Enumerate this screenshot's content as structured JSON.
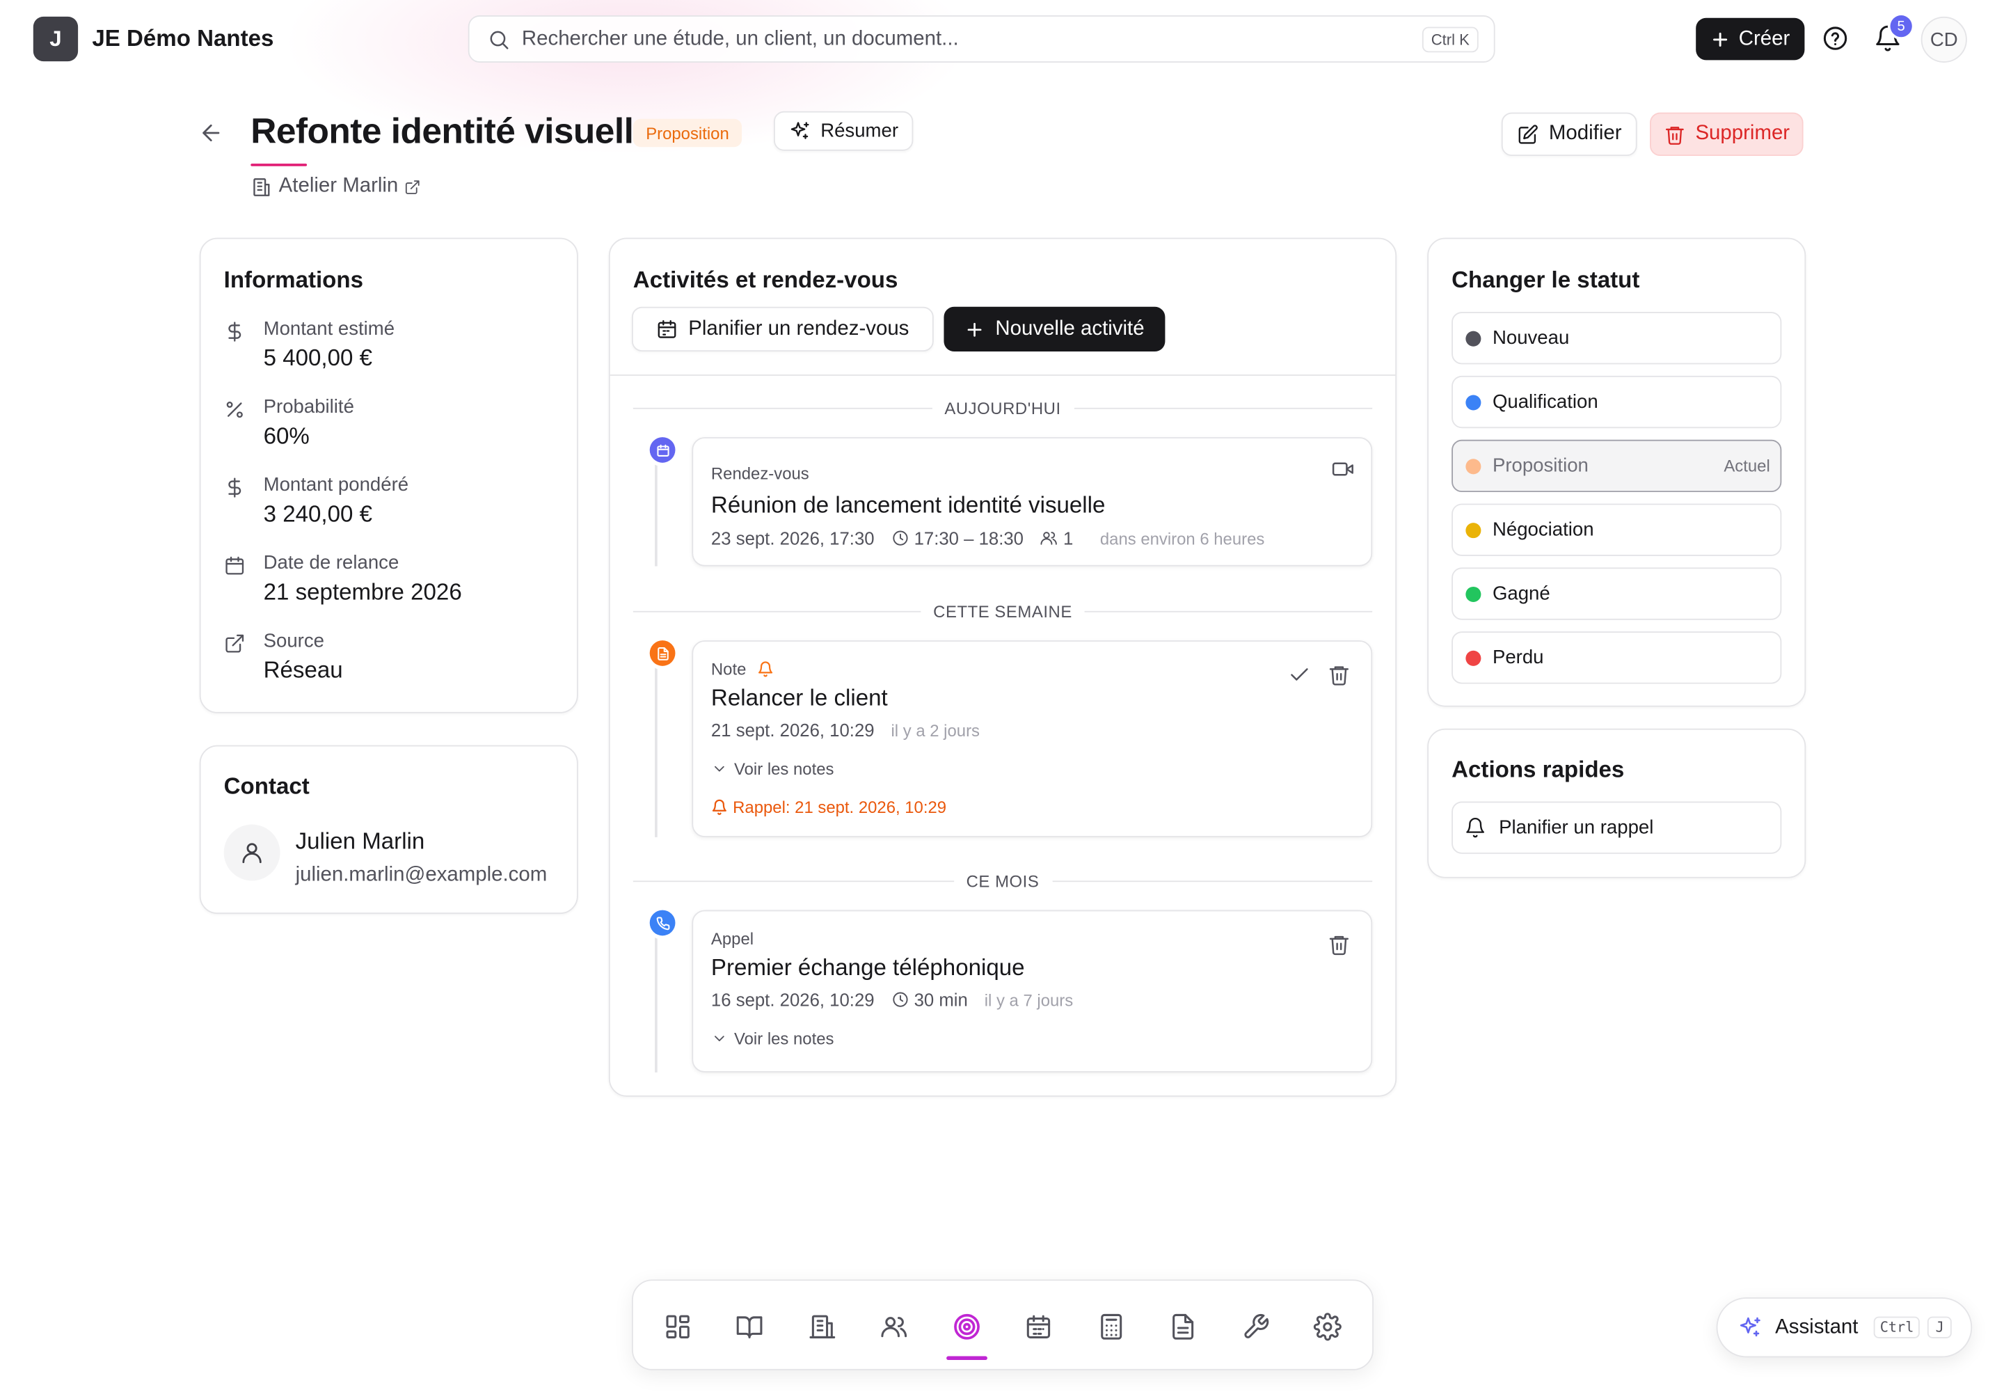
{
  "app": {
    "logo_letter": "J",
    "org_name": "JE Démo Nantes"
  },
  "search": {
    "placeholder": "Rechercher une étude, un client, un document...",
    "shortcut": "Ctrl K"
  },
  "topbar": {
    "create_label": "Créer",
    "notifications_count": "5",
    "avatar_initials": "CD"
  },
  "page": {
    "title": "Refonte identité visuelle",
    "status_badge": "Proposition",
    "summarize_label": "Résumer",
    "client_name": "Atelier Marlin",
    "edit_label": "Modifier",
    "delete_label": "Supprimer"
  },
  "info": {
    "title": "Informations",
    "rows": [
      {
        "label": "Montant estimé",
        "value": "5 400,00 €",
        "icon": "dollar-icon"
      },
      {
        "label": "Probabilité",
        "value": "60%",
        "icon": "percent-icon"
      },
      {
        "label": "Montant pondéré",
        "value": "3 240,00 €",
        "icon": "dollar-icon"
      },
      {
        "label": "Date de relance",
        "value": "21 septembre 2026",
        "icon": "calendar-icon"
      },
      {
        "label": "Source",
        "value": "Réseau",
        "icon": "external-link-icon"
      }
    ]
  },
  "contact": {
    "title": "Contact",
    "name": "Julien Marlin",
    "email": "julien.marlin@example.com"
  },
  "activities": {
    "title": "Activités et rendez-vous",
    "schedule_label": "Planifier un rendez-vous",
    "new_label": "Nouvelle activité",
    "groups": [
      "AUJOURD'HUI",
      "CETTE SEMAINE",
      "CE MOIS"
    ],
    "items": [
      {
        "type": "Rendez-vous",
        "title": "Réunion de lancement identité visuelle",
        "date": "23 sept. 2026, 17:30",
        "time_range": "17:30 – 18:30",
        "participants": "1",
        "relative": "dans environ 6 heures",
        "color": "#6366f1"
      },
      {
        "type": "Note",
        "title": "Relancer le client",
        "date": "21 sept. 2026, 10:29",
        "relative": "il y a 2 jours",
        "notes_toggle": "Voir les notes",
        "reminder": "Rappel: 21 sept. 2026, 10:29",
        "color": "#f97316"
      },
      {
        "type": "Appel",
        "title": "Premier échange téléphonique",
        "date": "16 sept. 2026, 10:29",
        "duration": "30 min",
        "relative": "il y a 7 jours",
        "notes_toggle": "Voir les notes",
        "color": "#3b82f6"
      }
    ]
  },
  "status": {
    "title": "Changer le statut",
    "current_label": "Actuel",
    "options": [
      {
        "label": "Nouveau",
        "color": "#52525b"
      },
      {
        "label": "Qualification",
        "color": "#3b82f6"
      },
      {
        "label": "Proposition",
        "color": "#fdba8c"
      },
      {
        "label": "Négociation",
        "color": "#eab308"
      },
      {
        "label": "Gagné",
        "color": "#22c55e"
      },
      {
        "label": "Perdu",
        "color": "#ef4444"
      }
    ]
  },
  "quick": {
    "title": "Actions rapides",
    "reminder_label": "Planifier un rappel"
  },
  "dock": {
    "items": [
      "dashboard-icon",
      "book-icon",
      "building-icon",
      "users-icon",
      "target-icon",
      "calendar-icon",
      "calculator-icon",
      "document-icon",
      "wrench-icon",
      "settings-icon"
    ],
    "active_color": "#c026d3"
  },
  "assistant": {
    "label": "Assistant",
    "key1": "Ctrl",
    "key2": "J"
  }
}
